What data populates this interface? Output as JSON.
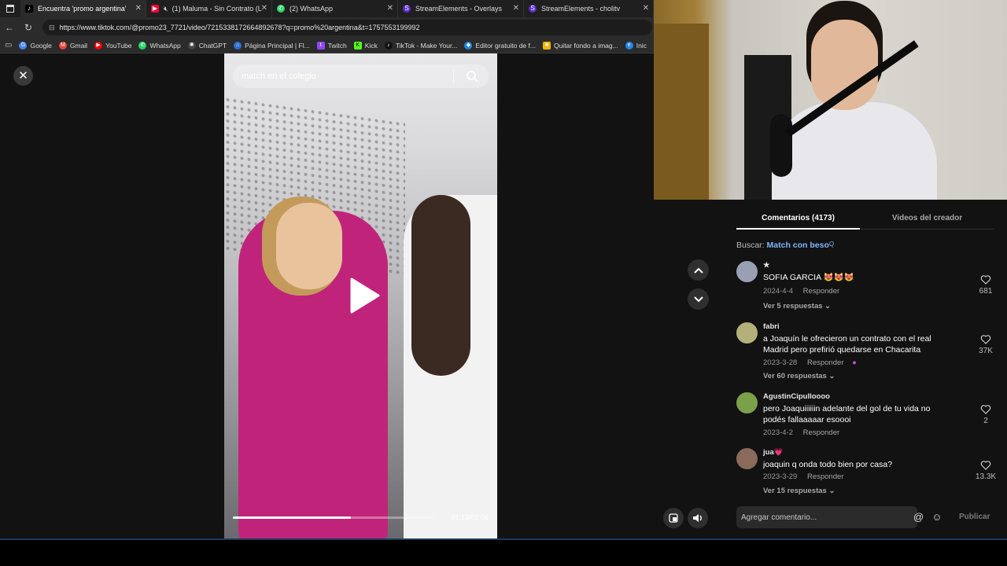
{
  "browser": {
    "tabs": [
      {
        "label": "Encuentra 'promo argentina'",
        "fav_color": "#000000",
        "active": true
      },
      {
        "label": "(1) Maluma - Sin Contrato (L",
        "fav_color": "#ff0033"
      },
      {
        "label": "(2) WhatsApp",
        "fav_color": "#25d366"
      },
      {
        "label": "StreamElements - Overlays",
        "fav_color": "#5b2fc9"
      },
      {
        "label": "StreamElements - cholitv",
        "fav_color": "#5b2fc9"
      }
    ],
    "url": "https://www.tiktok.com/@promo23_7721/video/7215338172664892678?q=promo%20argentina&t=1757553199992",
    "bookmarks": [
      {
        "label": "Google",
        "color": "#4285f4",
        "glyph": "G"
      },
      {
        "label": "Gmail",
        "color": "#ea4335",
        "glyph": "M"
      },
      {
        "label": "YouTube",
        "color": "#ff0000",
        "glyph": "▶"
      },
      {
        "label": "WhatsApp",
        "color": "#25d366",
        "glyph": "✆"
      },
      {
        "label": "ChatGPT",
        "color": "#444444",
        "glyph": "✺"
      },
      {
        "label": "Página Principal | Fl...",
        "color": "#2a6fd1",
        "glyph": "⌂"
      },
      {
        "label": "Twitch",
        "color": "#9146ff",
        "glyph": "t"
      },
      {
        "label": "Kick",
        "color": "#53fc18",
        "glyph": "K"
      },
      {
        "label": "TikTok - Make Your...",
        "color": "#111111",
        "glyph": "♪"
      },
      {
        "label": "Editor gratuito de f...",
        "color": "#1e88e5",
        "glyph": "◆"
      },
      {
        "label": "Quitar fondo a imag...",
        "color": "#f4b400",
        "glyph": "■"
      },
      {
        "label": "Inic",
        "color": "#1e88e5",
        "glyph": "e"
      }
    ]
  },
  "video": {
    "search_placeholder": "match en el colegio",
    "current_time": "01:13",
    "duration": "02:06",
    "timecode": "01:13/02:06",
    "progress": 0.59
  },
  "comments_panel": {
    "tab_comments": "Comentarios (4173)",
    "tab_creator": "Videos del creador",
    "search_prefix": "Buscar:",
    "search_term": "Match con beso",
    "comments": [
      {
        "user": "★",
        "text": "SOFIA GARCIA 😻😻😻",
        "date": "2024-4-4",
        "reply": "Responder",
        "replies": "Ver 5 respuestas ⌄",
        "likes": "681",
        "avatar_color": "#9aa0b4"
      },
      {
        "user": "fabri",
        "text": "a Joaquín le ofrecieron un contrato con el real Madrid pero prefirió quedarse en Chacarita",
        "date": "2023-3-28",
        "reply": "Responder",
        "replies": "Ver 60 respuestas ⌄",
        "likes": "37K",
        "avatar_color": "#b5b07a"
      },
      {
        "user": "AgustinCipulloooo",
        "text": "pero Joaquiiiiiin adelante del gol de tu vida no podés fallaaaaar esoooi",
        "date": "2023-4-2",
        "reply": "Responder",
        "replies": "",
        "likes": "2",
        "avatar_color": "#7aa04a"
      },
      {
        "user": "jua💗",
        "text": "joaquin q onda todo bien por casa?",
        "date": "2023-3-29",
        "reply": "Responder",
        "replies": "Ver 15 respuestas ⌄",
        "likes": "13.3K",
        "avatar_color": "#8a6a5a"
      }
    ],
    "composer_placeholder": "Agregar comentario...",
    "publish_label": "Publicar"
  }
}
